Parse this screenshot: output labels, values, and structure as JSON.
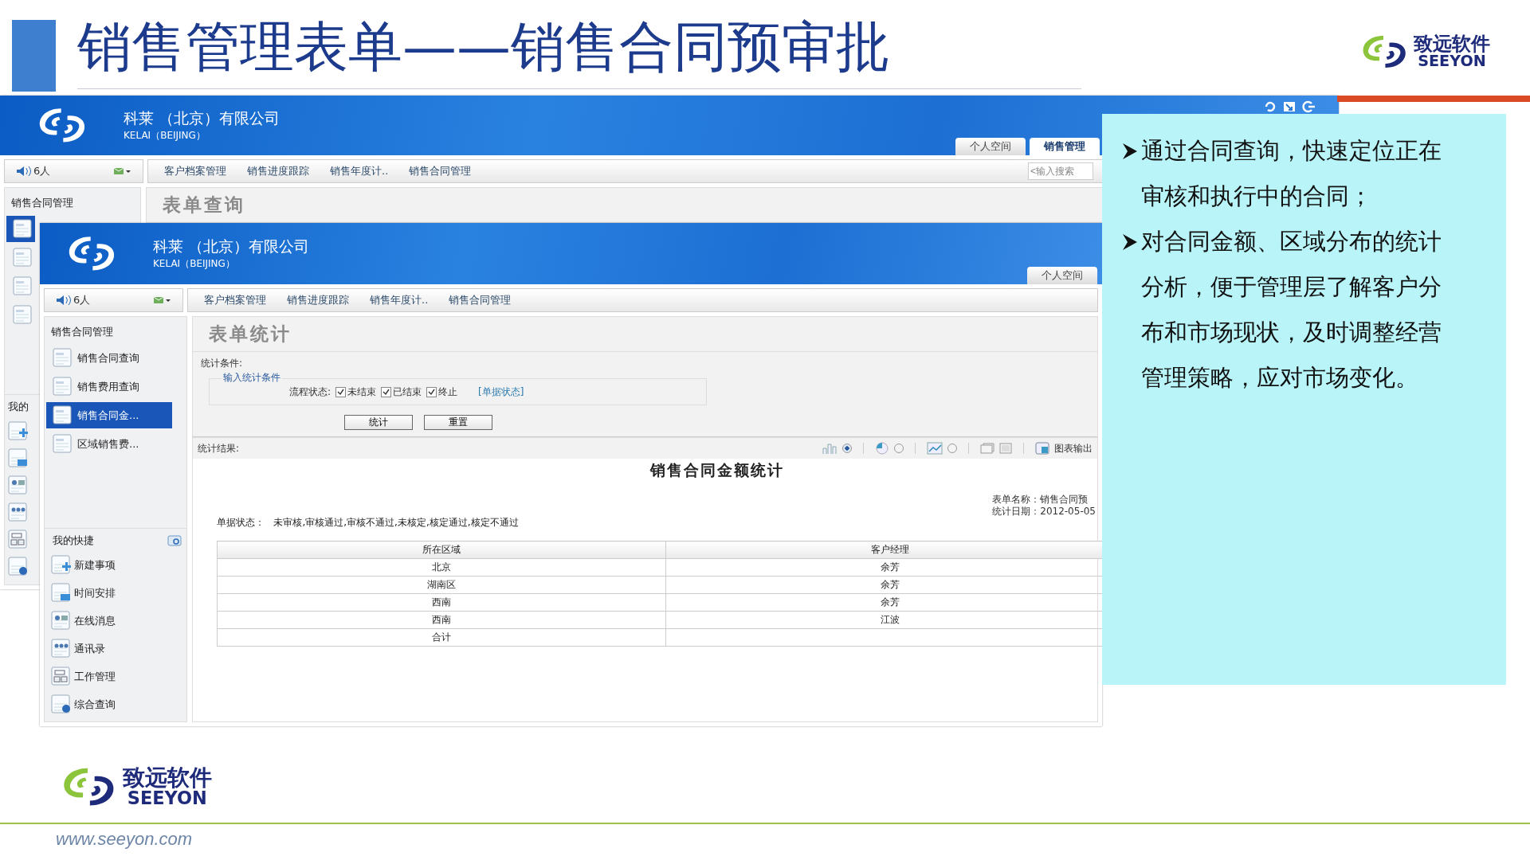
{
  "slide": {
    "title": "销售管理表单——销售合同预审批",
    "url": "www.seeyon.com"
  },
  "header_logo": {
    "name": "致远软件",
    "sub": "SEEYON"
  },
  "footer_logo": {
    "name": "致远软件",
    "sub": "SEEYON"
  },
  "back_window": {
    "company": "科莱 （北京）有限公司",
    "company_en": "KELAI（BEIJING）",
    "tabs": [
      {
        "label": "个人空间",
        "selected": false
      },
      {
        "label": "销售管理",
        "selected": true
      }
    ],
    "online": "6人",
    "nav": [
      "客户档案管理",
      "销售进度跟踪",
      "销售年度计..",
      "销售合同管理"
    ],
    "search": {
      "placeholder": "<输入搜索"
    },
    "sidebar_title": "销售合同管理",
    "sidebar_items": [
      {
        "selected": true
      },
      {
        "selected": false
      },
      {
        "selected": false
      },
      {
        "selected": false
      }
    ],
    "shortcut_title": "我的",
    "page_title": "表单查询"
  },
  "front_window": {
    "company": "科莱 （北京）有限公司",
    "company_en": "KELAI（BEIJING）",
    "tabs": [
      {
        "label": "个人空间",
        "selected": false
      }
    ],
    "online": "6人",
    "nav": [
      "客户档案管理",
      "销售进度跟踪",
      "销售年度计..",
      "销售合同管理"
    ],
    "sidebar_title": "销售合同管理",
    "sidebar_items": [
      {
        "label": "销售合同查询",
        "selected": false
      },
      {
        "label": "销售费用查询",
        "selected": false
      },
      {
        "label": "销售合同金...",
        "selected": true
      },
      {
        "label": "区域销售费...",
        "selected": false
      }
    ],
    "shortcut_title": "我的快捷",
    "shortcuts": [
      {
        "kind": "new",
        "label": "新建事项"
      },
      {
        "kind": "schedule",
        "label": "时间安排"
      },
      {
        "kind": "message",
        "label": "在线消息"
      },
      {
        "kind": "contacts",
        "label": "通讯录"
      },
      {
        "kind": "work",
        "label": "工作管理"
      },
      {
        "kind": "query",
        "label": "综合查询"
      }
    ],
    "form": {
      "title": "表单统计",
      "conditions_label": "统计条件:",
      "legend": "输入统计条件",
      "status_label": "流程状态:",
      "checks": [
        {
          "label": "未结束",
          "checked": true
        },
        {
          "label": "已结束",
          "checked": true
        },
        {
          "label": "终止",
          "checked": true
        }
      ],
      "link": "[单据状态]",
      "buttons": [
        "统计",
        "重置"
      ]
    },
    "results": {
      "label": "统计结果:",
      "chart_types": [
        {
          "kind": "bar",
          "selected": true
        },
        {
          "kind": "pie",
          "selected": false
        },
        {
          "kind": "line",
          "selected": false
        }
      ],
      "export": "图表输出",
      "report_title": "销售合同金额统计",
      "meta": [
        "表单名称：销售合同预",
        "统计日期：2012-05-05"
      ],
      "doc_status_label": "单据状态：",
      "doc_status": "未审核,审核通过,审核不通过,未核定,核定通过,核定不通过",
      "columns": [
        "所在区域",
        "客户经理"
      ],
      "rows": [
        {
          "region": "北京",
          "manager": "余芳"
        },
        {
          "region": "湖南区",
          "manager": "余芳"
        },
        {
          "region": "西南",
          "manager": "余芳"
        },
        {
          "region": "西南",
          "manager": "江波"
        },
        {
          "region": "合计"
        }
      ]
    }
  },
  "points": [
    "通过合同查询，快速定位正在审核和执行中的合同；",
    "对合同金额、区域分布的统计分析，便于管理层了解客户分布和市场现状，及时调整经营管理策略，应对市场变化。"
  ]
}
